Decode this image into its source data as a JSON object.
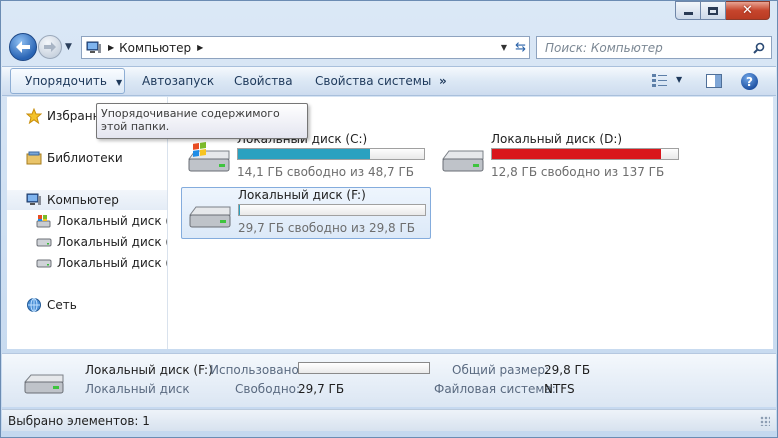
{
  "window": {
    "accent": "#c6452c",
    "caption_buttons": [
      "minimize-icon",
      "maximize-icon",
      "close-icon"
    ]
  },
  "address_bar": {
    "location": "Компьютер"
  },
  "search": {
    "placeholder": "Поиск: Компьютер"
  },
  "toolbar": {
    "organize": "Упорядочить",
    "autorun": "Автозапуск",
    "properties": "Свойства",
    "system_properties": "Свойства системы",
    "more": "»"
  },
  "tooltip": {
    "text": "Упорядочивание содержимого этой папки."
  },
  "sidebar": {
    "favorites": "Избранное",
    "libraries": "Библиотеки",
    "computer": "Компьютер",
    "drives": [
      {
        "label": "Локальный диск (C:)"
      },
      {
        "label": "Локальный диск (D:)"
      },
      {
        "label": "Локальный диск (F:)"
      }
    ],
    "network": "Сеть"
  },
  "drives": [
    {
      "name": "Локальный диск (C:)",
      "free_text": "14,1 ГБ свободно из 48,7 ГБ",
      "used_fraction": 0.71,
      "bar_color": "#2aa1c0"
    },
    {
      "name": "Локальный диск (D:)",
      "free_text": "12,8 ГБ свободно из 137 ГБ",
      "used_fraction": 0.91,
      "bar_color": "#d9161c"
    },
    {
      "name": "Локальный диск (F:)",
      "free_text": "29,7 ГБ свободно из 29,8 ГБ",
      "used_fraction": 0.003,
      "bar_color": "#2aa1c0"
    }
  ],
  "details": {
    "title": "Локальный диск (F:)",
    "subtitle": "Локальный диск",
    "used_label": "Использовано:",
    "free_label": "Свободно:",
    "free_value": "29,7 ГБ",
    "total_label": "Общий размер:",
    "total_value": "29,8 ГБ",
    "fs_label": "Файловая система:",
    "fs_value": "NTFS"
  },
  "status": {
    "text": "Выбрано элементов: 1"
  }
}
